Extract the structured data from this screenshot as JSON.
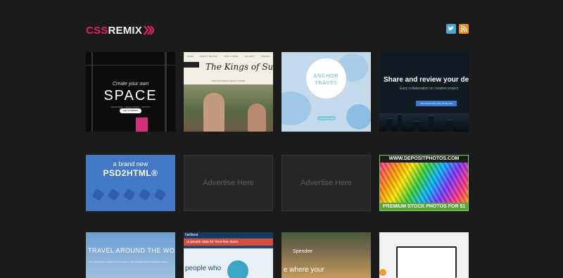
{
  "header": {
    "logo_css": "CSS",
    "logo_remix": "REMIX",
    "social": [
      "twitter-icon",
      "rss-icon"
    ]
  },
  "tiles": {
    "space": {
      "create": "Create your own",
      "title": "SPACE",
      "sub": "DESIGNERS • DEVELOPERS • ARTISTS",
      "button": "GET STARTED"
    },
    "kings": {
      "nav": [
        "HOME",
        "ABOUT THE FILM",
        "CAST & CREW",
        "GALLERY",
        "TRAILER"
      ],
      "title": "The Kings of Summer",
      "tag": "NOW PLAYING IN SELECT CITIES"
    },
    "anchor": {
      "line1": "ANCHOR",
      "line2": "TRAVEL",
      "button": "enter your email"
    },
    "share": {
      "headline": "Share and review your de",
      "sub": "Easy collaboration on creative project",
      "button": "Get started with a free 30 day trial"
    },
    "psd": {
      "line1": "a brand new",
      "line2": "PSD2HTML®"
    },
    "advertise": "Advertise Here",
    "deposit": {
      "top": "WWW.DEPOSITPHOTOS.COM",
      "bottom": "PREMIUM STOCK PHOTOS FOR $1"
    },
    "travel": {
      "title": "TRAVEL AROUND THE WO",
      "text": "This is Photoshop's version of Lorem Ipsum. Proin gravida nibh vel velit auctor aliquet."
    },
    "heart": {
      "brand": "hartbeat",
      "headline": "ut people data for front-line doers",
      "big": "people who"
    },
    "spendee": {
      "brand": "Spendee",
      "big": "e where your"
    }
  }
}
